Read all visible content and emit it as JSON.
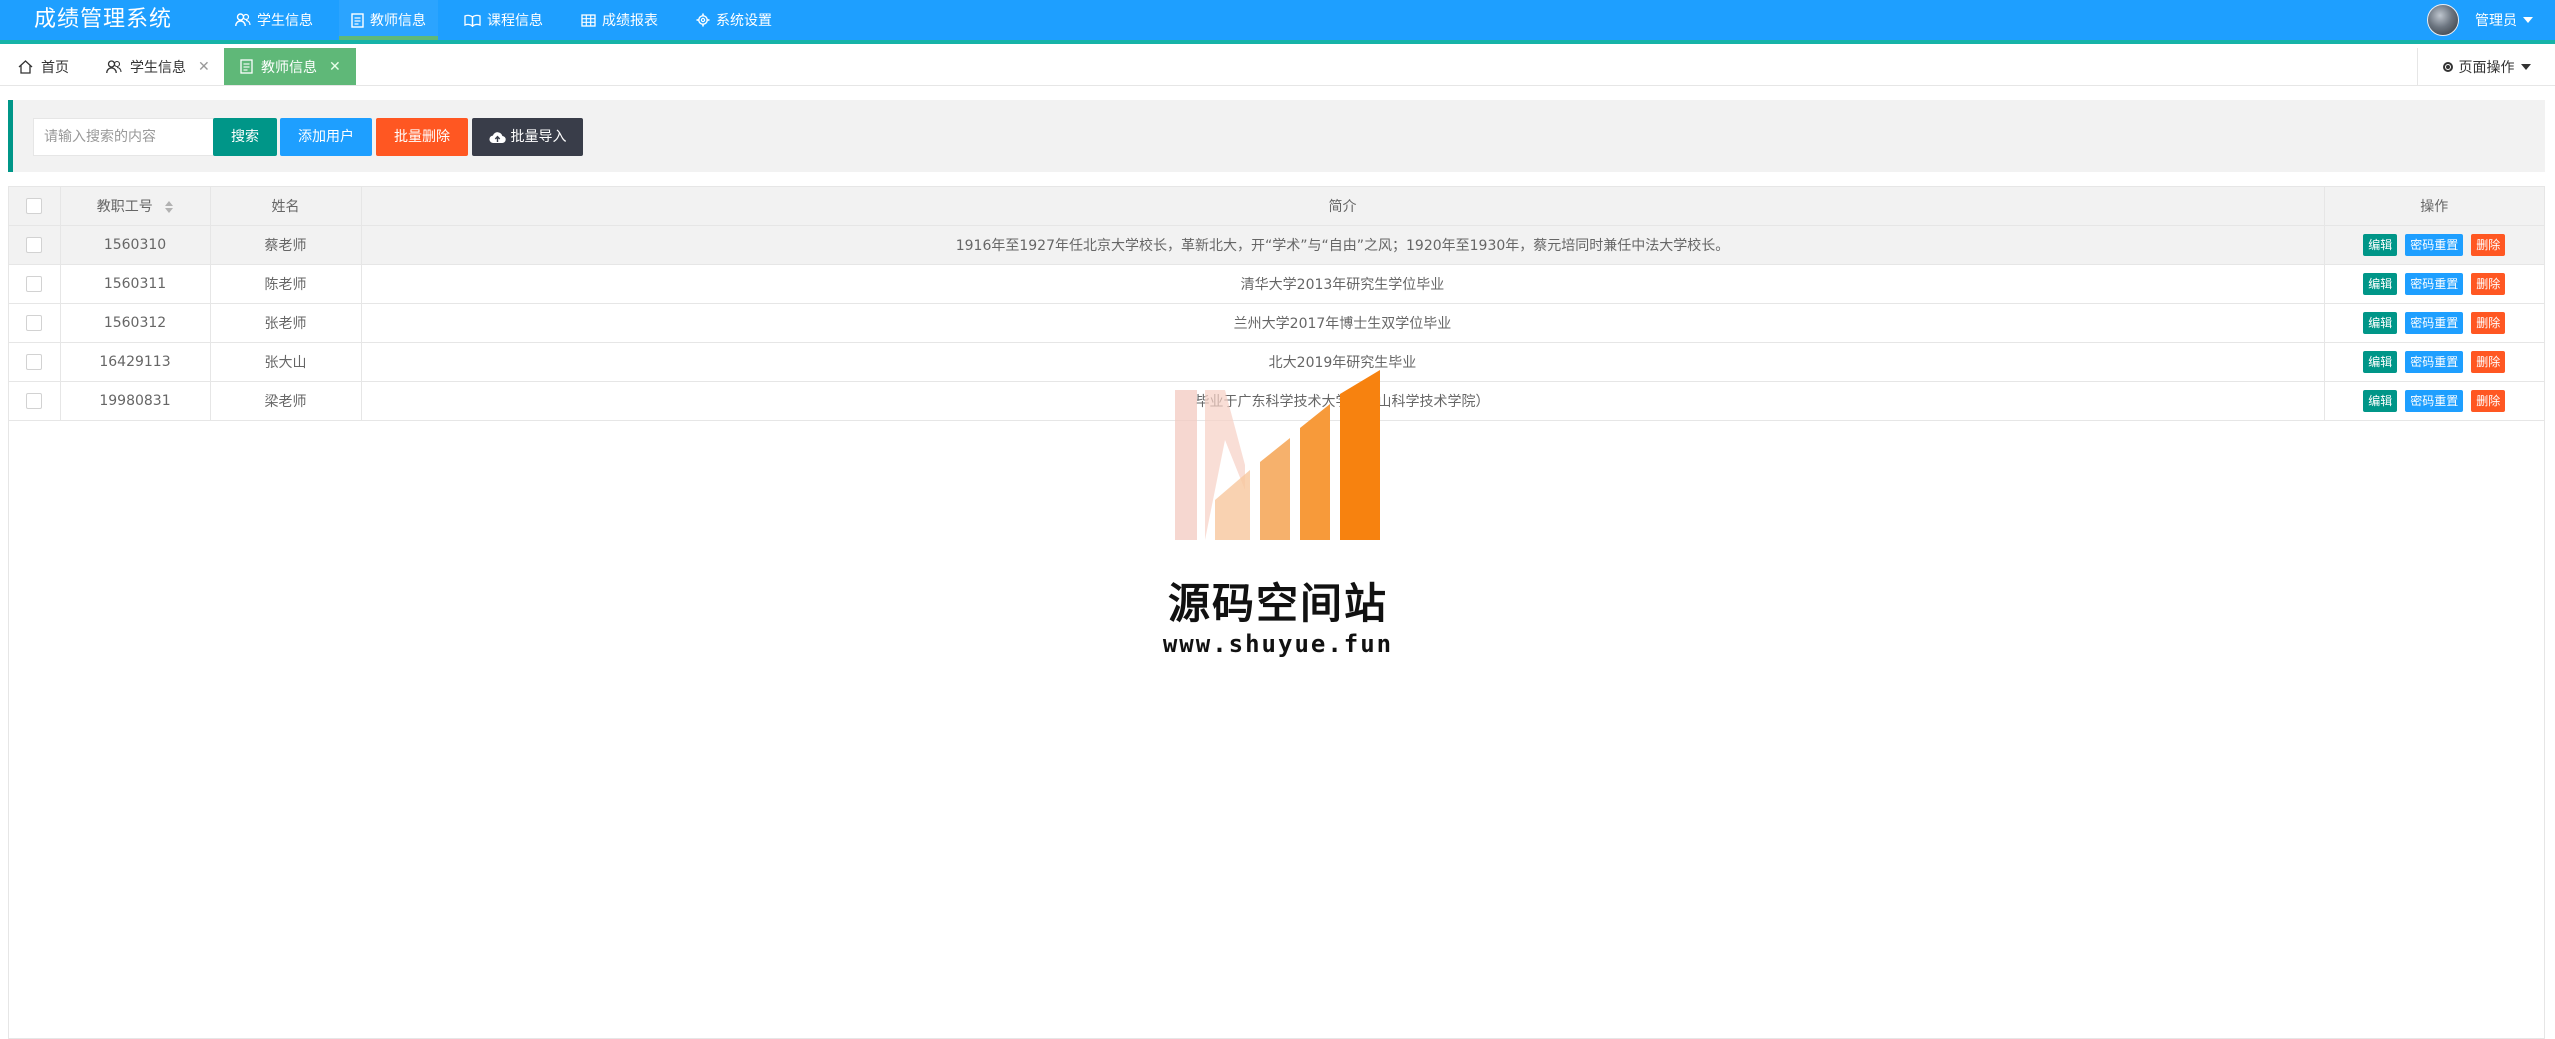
{
  "app": {
    "title": "成绩管理系统"
  },
  "nav": {
    "items": [
      {
        "label": "学生信息",
        "icon": "users-icon"
      },
      {
        "label": "教师信息",
        "icon": "document-icon",
        "active": true
      },
      {
        "label": "课程信息",
        "icon": "book-icon"
      },
      {
        "label": "成绩报表",
        "icon": "table-icon"
      },
      {
        "label": "系统设置",
        "icon": "gear-icon"
      }
    ]
  },
  "user": {
    "name": "管理员"
  },
  "tabs": {
    "home": "首页",
    "items": [
      {
        "label": "学生信息",
        "close": "✕"
      },
      {
        "label": "教师信息",
        "close": "✕",
        "active": true
      }
    ],
    "page_ops": "页面操作"
  },
  "toolbar": {
    "search_placeholder": "请输入搜索的内容",
    "search": "搜索",
    "add_user": "添加用户",
    "batch_delete": "批量删除",
    "batch_import": "批量导入"
  },
  "table": {
    "headers": {
      "id": "教职工号",
      "name": "姓名",
      "intro": "简介",
      "ops": "操作"
    },
    "row_actions": {
      "edit": "编辑",
      "reset": "密码重置",
      "delete": "删除"
    },
    "rows": [
      {
        "id": "1560310",
        "name": "蔡老师",
        "intro": "1916年至1927年任北京大学校长，革新北大，开“学术”与“自由”之风；1920年至1930年，蔡元培同时兼任中法大学校长。"
      },
      {
        "id": "1560311",
        "name": "陈老师",
        "intro": "清华大学2013年研究生学位毕业"
      },
      {
        "id": "1560312",
        "name": "张老师",
        "intro": "兰州大学2017年博士生双学位毕业"
      },
      {
        "id": "16429113",
        "name": "张大山",
        "intro": "北大2019年研究生毕业"
      },
      {
        "id": "19980831",
        "name": "梁老师",
        "intro": "毕业于广东科学技术大学（佛山科学技术学院）"
      }
    ]
  },
  "watermark": {
    "title": "源码空间站",
    "url": "www.shuyue.fun"
  },
  "colors": {
    "header": "#1e9fff",
    "accent_green": "#5fb878",
    "teal": "#009688",
    "blue": "#1e9fff",
    "orange": "#ff5722",
    "dark": "#393d49"
  }
}
